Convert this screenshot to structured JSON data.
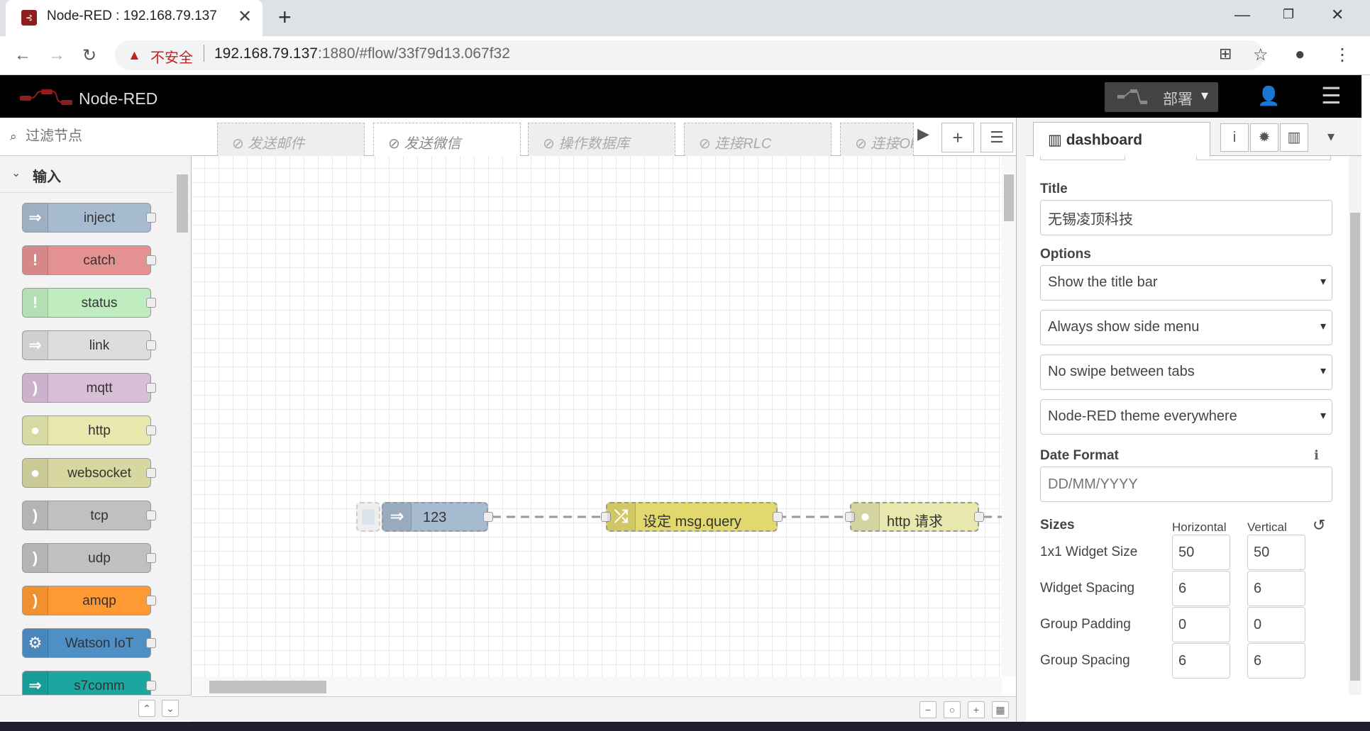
{
  "browser": {
    "tab_title": "Node-RED : 192.168.79.137",
    "tab_close": "✕",
    "new_tab": "+",
    "insecure_label": "不安全",
    "url_host": "192.168.79.137",
    "url_rest": ":1880/#flow/33f79d13.067f32",
    "min": "—",
    "restore": "❐",
    "close": "✕",
    "back": "←",
    "forward": "→",
    "reload": "↻",
    "translate": "⊞",
    "star": "☆",
    "account": "●",
    "more": "⋮"
  },
  "header": {
    "brand": "Node-RED",
    "deploy_label": "部署",
    "deploy_caret": "▾",
    "user_icon": "👤",
    "menu_icon": "☰"
  },
  "palette": {
    "filter_placeholder": "过滤节点",
    "filter_icon": "⌕",
    "category_chevron": "⌄",
    "category_label": "输入",
    "nodes": [
      {
        "label": "inject",
        "color": "#a6bbcf",
        "icon": "⇒"
      },
      {
        "label": "catch",
        "color": "#e49191",
        "icon": "!"
      },
      {
        "label": "status",
        "color": "#c0edc0",
        "icon": "!"
      },
      {
        "label": "link",
        "color": "#dddddd",
        "icon": "⇒"
      },
      {
        "label": "mqtt",
        "color": "#d8bfd8",
        "icon": ")"
      },
      {
        "label": "http",
        "color": "#e7e7ae",
        "icon": "●"
      },
      {
        "label": "websocket",
        "color": "#d7d7a0",
        "icon": "●"
      },
      {
        "label": "tcp",
        "color": "#c0c0c0",
        "icon": ")"
      },
      {
        "label": "udp",
        "color": "#c0c0c0",
        "icon": ")"
      },
      {
        "label": "amqp",
        "color": "#ff9933",
        "icon": ")"
      },
      {
        "label": "Watson IoT",
        "color": "#4e8fc5",
        "icon": "⚙"
      },
      {
        "label": "s7comm",
        "color": "#1ba6a1",
        "icon": "⇒"
      }
    ],
    "collapse_up": "⌃",
    "collapse_down": "⌄"
  },
  "workspace": {
    "tabs": [
      "⊘ 发送邮件",
      "⊘ 发送微信",
      "⊘ 操作数据库",
      "⊘ 连接RLC",
      "⊘ 连接OPC"
    ],
    "tab_scroll": "▶",
    "add_flow": "+",
    "flow_list": "☰",
    "nodes": [
      {
        "label": "123",
        "color": "#a6bbcf",
        "icon": "⇒"
      },
      {
        "label": "设定 msg.query",
        "color": "#e2d96e",
        "icon": "⤮"
      },
      {
        "label": "http 请求",
        "color": "#e7e7ae",
        "icon": "●"
      }
    ],
    "zoom_out": "−",
    "zoom_reset": "○",
    "zoom_in": "+",
    "navigator": "▦"
  },
  "sidebar": {
    "tab_label": "dashboard",
    "info_icon": "i",
    "debug_icon": "✹",
    "chart_icon": "▥",
    "dropdown_icon": "▾",
    "title_label": "Title",
    "title_value": "无锡凌顶科技",
    "options_label": "Options",
    "option_titlebar": "Show the title bar",
    "option_sidemenu": "Always show side menu",
    "option_swipe": "No swipe between tabs",
    "option_theme": "Node-RED theme everywhere",
    "select_caret": "▾",
    "date_format_label": "Date Format",
    "date_format_info": "ℹ",
    "date_format_placeholder": "DD/MM/YYYY",
    "sizes_label": "Sizes",
    "horizontal_label": "Horizontal",
    "vertical_label": "Vertical",
    "reset_icon": "↺",
    "sizes": [
      {
        "label": "1x1 Widget Size",
        "h": "50",
        "v": "50"
      },
      {
        "label": "Widget Spacing",
        "h": "6",
        "v": "6"
      },
      {
        "label": "Group Padding",
        "h": "0",
        "v": "0"
      },
      {
        "label": "Group Spacing",
        "h": "6",
        "v": "6"
      }
    ]
  }
}
